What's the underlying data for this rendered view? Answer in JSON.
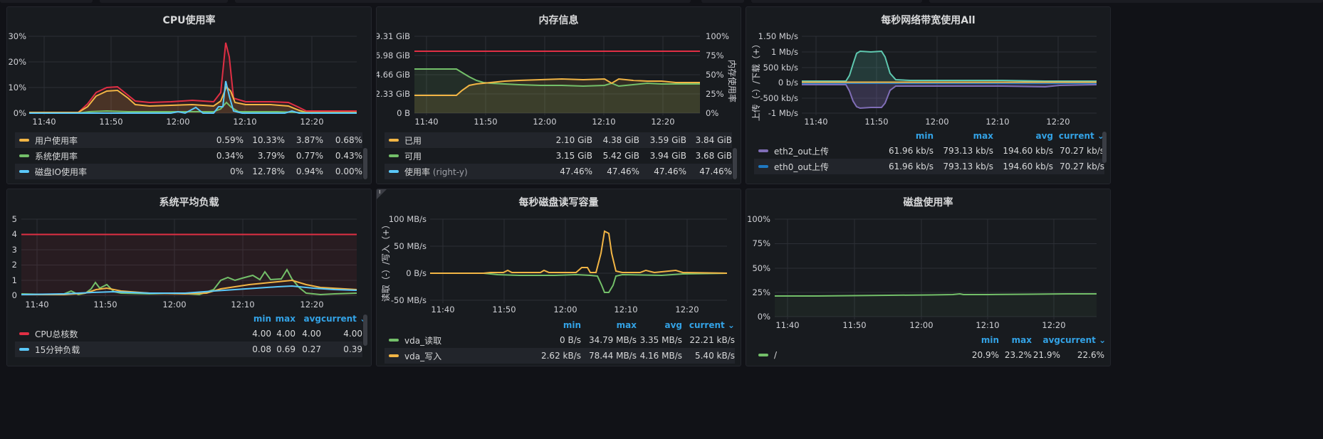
{
  "colors": {
    "red": "#e02f44",
    "yellow": "#fade2a",
    "orange": "#f2b545",
    "green": "#73bf69",
    "cyan": "#5ac8fa",
    "blue": "#1f78c1",
    "purple": "#806eb7",
    "teal": "#5fc9b0",
    "grid": "#2c2f36"
  },
  "cpu": {
    "title": "CPU使用率",
    "yticks": [
      "30%",
      "20%",
      "10%",
      "0%"
    ],
    "xticks": [
      "11:40",
      "11:50",
      "12:00",
      "12:10",
      "12:20"
    ],
    "legend": [
      {
        "name": "用户使用率",
        "color": "#f2b545",
        "min": "0.59%",
        "max": "10.33%",
        "avg": "3.87%",
        "current": "0.68%"
      },
      {
        "name": "系统使用率",
        "color": "#73bf69",
        "min": "0.34%",
        "max": "3.79%",
        "avg": "0.77%",
        "current": "0.43%"
      },
      {
        "name": "磁盘IO使用率",
        "color": "#5ac8fa",
        "min": "0%",
        "max": "12.78%",
        "avg": "0.94%",
        "current": "0.00%"
      }
    ]
  },
  "mem": {
    "title": "内存信息",
    "yticks": [
      "9.31 GiB",
      "6.98 GiB",
      "4.66 GiB",
      "2.33 GiB",
      "0 B"
    ],
    "y2ticks": [
      "100%",
      "75%",
      "50%",
      "25%",
      "0%"
    ],
    "y2label": "内存使用率",
    "xticks": [
      "11:40",
      "11:50",
      "12:00",
      "12:10",
      "12:20"
    ],
    "legend": [
      {
        "name": "已用",
        "suffix": "",
        "color": "#f2b545",
        "min": "2.10 GiB",
        "max": "4.38 GiB",
        "avg": "3.59 GiB",
        "current": "3.84 GiB"
      },
      {
        "name": "可用",
        "suffix": "",
        "color": "#73bf69",
        "min": "3.15 GiB",
        "max": "5.42 GiB",
        "avg": "3.94 GiB",
        "current": "3.68 GiB"
      },
      {
        "name": "使用率",
        "suffix": "(right-y)",
        "color": "#5ac8fa",
        "min": "47.46%",
        "max": "47.46%",
        "avg": "47.46%",
        "current": "47.46%"
      }
    ]
  },
  "net": {
    "title": "每秒网络带宽使用All",
    "yticks": [
      "1.50 Mb/s",
      "1 Mb/s",
      "500 kb/s",
      "0 b/s",
      "-500 kb/s",
      "-1 Mb/s"
    ],
    "ylabel": "上传（-）/下载（+）",
    "xticks": [
      "11:40",
      "11:50",
      "12:00",
      "12:10",
      "12:20"
    ],
    "headers": {
      "min": "min",
      "max": "max",
      "avg": "avg",
      "current": "current ⌄"
    },
    "legend": [
      {
        "name": "eth2_out上传",
        "color": "#806eb7",
        "min": "61.96 kb/s",
        "max": "793.13 kb/s",
        "avg": "194.60 kb/s",
        "current": "70.27 kb/s"
      },
      {
        "name": "eth0_out上传",
        "color": "#1f78c1",
        "min": "61.96 kb/s",
        "max": "793.13 kb/s",
        "avg": "194.60 kb/s",
        "current": "70.27 kb/s"
      }
    ]
  },
  "load": {
    "title": "系统平均负载",
    "yticks": [
      "5",
      "4",
      "3",
      "2",
      "1",
      "0"
    ],
    "xticks": [
      "11:40",
      "11:50",
      "12:00",
      "12:10",
      "12:20"
    ],
    "headers": {
      "min": "min",
      "max": "max",
      "avg": "avg",
      "current": "current ⌄"
    },
    "legend": [
      {
        "name": "CPU总核数",
        "color": "#e02f44",
        "min": "4.00",
        "max": "4.00",
        "avg": "4.00",
        "current": "4.00"
      },
      {
        "name": "15分钟负载",
        "color": "#5ac8fa",
        "min": "0.08",
        "max": "0.69",
        "avg": "0.27",
        "current": "0.39"
      }
    ]
  },
  "disk": {
    "title": "每秒磁盘读写容量",
    "badge": "i",
    "yticks": [
      "100 MB/s",
      "50 MB/s",
      "0 B/s",
      "-50 MB/s"
    ],
    "ylabel": "读取（-）/写入（+）",
    "xticks": [
      "11:40",
      "11:50",
      "12:00",
      "12:10",
      "12:20"
    ],
    "headers": {
      "min": "min",
      "max": "max",
      "avg": "avg",
      "current": "current ⌄"
    },
    "legend": [
      {
        "name": "vda_读取",
        "color": "#73bf69",
        "min": "0 B/s",
        "max": "34.79 MB/s",
        "avg": "3.35 MB/s",
        "current": "22.21 kB/s"
      },
      {
        "name": "vda_写入",
        "color": "#f2b545",
        "min": "2.62 kB/s",
        "max": "78.44 MB/s",
        "avg": "4.16 MB/s",
        "current": "5.40 kB/s"
      }
    ]
  },
  "usage": {
    "title": "磁盘使用率",
    "yticks": [
      "100%",
      "75%",
      "50%",
      "25%",
      "0%"
    ],
    "xticks": [
      "11:40",
      "11:50",
      "12:00",
      "12:10",
      "12:20"
    ],
    "headers": {
      "min": "min",
      "max": "max",
      "avg": "avg",
      "current": "current ⌄"
    },
    "legend": [
      {
        "name": "/",
        "color": "#73bf69",
        "min": "20.9%",
        "max": "23.2%",
        "avg": "21.9%",
        "current": "22.6%"
      }
    ]
  }
}
